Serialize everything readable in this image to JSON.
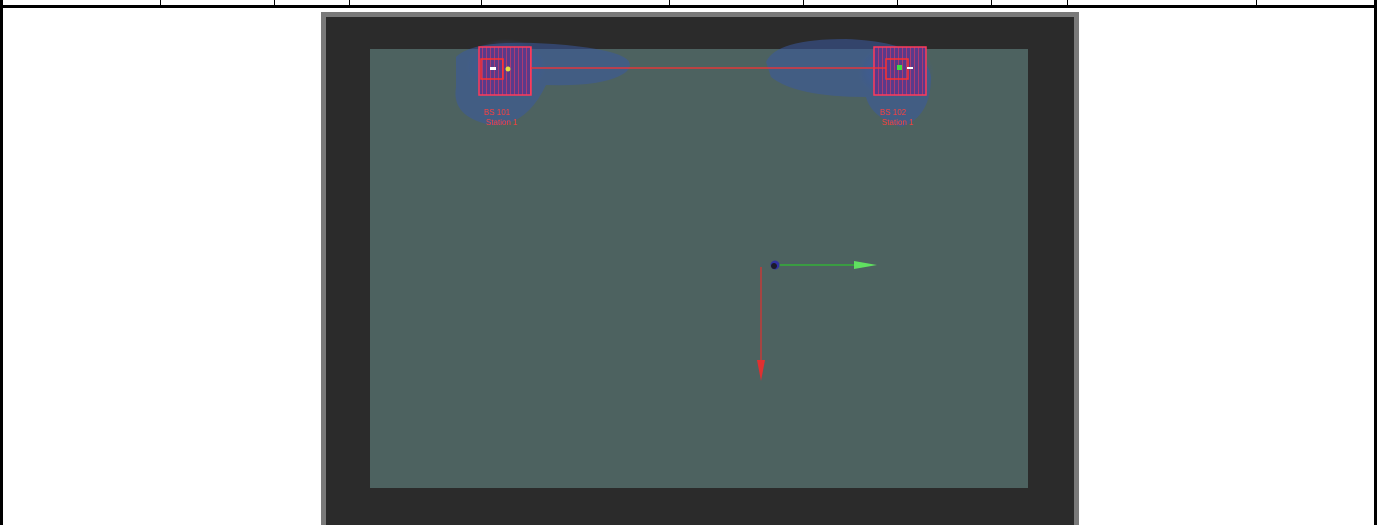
{
  "scene": {
    "station_left": {
      "label_line1": "BS 101",
      "label_line2": "Station 1"
    },
    "station_right": {
      "label_line1": "BS 102",
      "label_line2": "Station 1"
    }
  },
  "colors": {
    "field": "#4d6260",
    "frame_outer": "#7a7a7a",
    "frame_inner": "#2b2b2b",
    "red": "#ff3030",
    "green": "#30d030",
    "blue_glow": "#3a5aa0"
  }
}
